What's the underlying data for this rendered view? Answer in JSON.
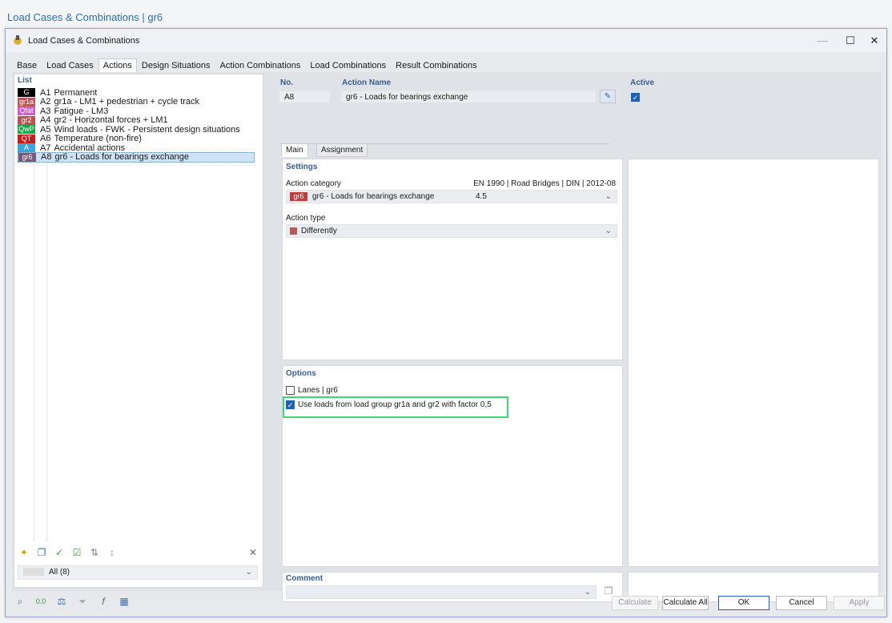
{
  "breadcrumb": "Load Cases & Combinations | gr6",
  "window": {
    "title": "Load Cases & Combinations"
  },
  "tabs": [
    "Base",
    "Load Cases",
    "Actions",
    "Design Situations",
    "Action Combinations",
    "Load Combinations",
    "Result Combinations"
  ],
  "list": {
    "label": "List",
    "items": [
      {
        "badge": "G",
        "color": "#000000",
        "id": "A1",
        "name": "Permanent"
      },
      {
        "badge": "gr1a",
        "color": "#b85a5a",
        "id": "A2",
        "name": "gr1a - LM1 + pedestrian + cycle track"
      },
      {
        "badge": "Qfat",
        "color": "#d658d6",
        "id": "A3",
        "name": "Fatigue - LM3"
      },
      {
        "badge": "gr2",
        "color": "#c05050",
        "id": "A4",
        "name": "gr2 - Horizontal forces + LM1"
      },
      {
        "badge": "QwP",
        "color": "#1fa34a",
        "id": "A5",
        "name": "Wind loads - FWK - Persistent design situations"
      },
      {
        "badge": "QT",
        "color": "#c81b1b",
        "id": "A6",
        "name": "Temperature (non-fire)"
      },
      {
        "badge": "A",
        "color": "#3ea3d8",
        "id": "A7",
        "name": "Accidental actions"
      },
      {
        "badge": "gr6",
        "color": "#7a5a7a",
        "id": "A8",
        "name": "gr6 - Loads for bearings exchange"
      }
    ],
    "filter": "All (8)"
  },
  "header": {
    "no_label": "No.",
    "no_value": "A8",
    "name_label": "Action Name",
    "name_value": "gr6 - Loads for bearings exchange",
    "active_label": "Active"
  },
  "subtabs": [
    "Main",
    "Assignment"
  ],
  "settings": {
    "label": "Settings",
    "category_label": "Action category",
    "norm": "EN 1990 | Road Bridges | DIN | 2012-08",
    "category_badge": "gr6",
    "category_value": "gr6 - Loads for bearings exchange",
    "category_code": "4.5",
    "type_label": "Action type",
    "type_value": "Differently"
  },
  "options": {
    "label": "Options",
    "lanes": "Lanes | gr6",
    "use_loads": "Use loads from load group gr1a and gr2 with factor 0,5"
  },
  "comment": {
    "label": "Comment"
  },
  "buttons": {
    "calculate": "Calculate",
    "calculate_all": "Calculate All",
    "ok": "OK",
    "cancel": "Cancel",
    "apply": "Apply"
  }
}
